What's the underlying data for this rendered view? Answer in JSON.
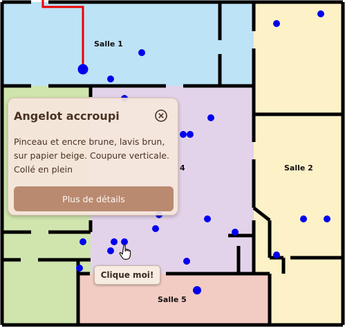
{
  "rooms": [
    {
      "id": "salle-1",
      "label": "Salle 1",
      "color": "#bde3f6"
    },
    {
      "id": "salle-2",
      "label": "Salle 2",
      "color": "#fdf1c7"
    },
    {
      "id": "salle-4",
      "label": "4",
      "color": "#e3d3ea"
    },
    {
      "id": "salle-5",
      "label": "Salle 5",
      "color": "#f2cbc2"
    },
    {
      "id": "left-room",
      "label": "",
      "color": "#d0e5ae"
    }
  ],
  "markers": {
    "color": "#0000ee",
    "selected_color": "#0000ee"
  },
  "path": {
    "color": "#ee0000"
  },
  "popup": {
    "title": "Angelot accroupi",
    "description": "Pinceau et encre brune, lavis brun, sur papier beige. Coupure verticale. Collé en plein",
    "details_button": "Plus de détails",
    "close_icon": "close-circle-icon"
  },
  "tooltip": {
    "text": "Clique moi!"
  },
  "cursor": {
    "icon": "hand-pointer-icon"
  }
}
